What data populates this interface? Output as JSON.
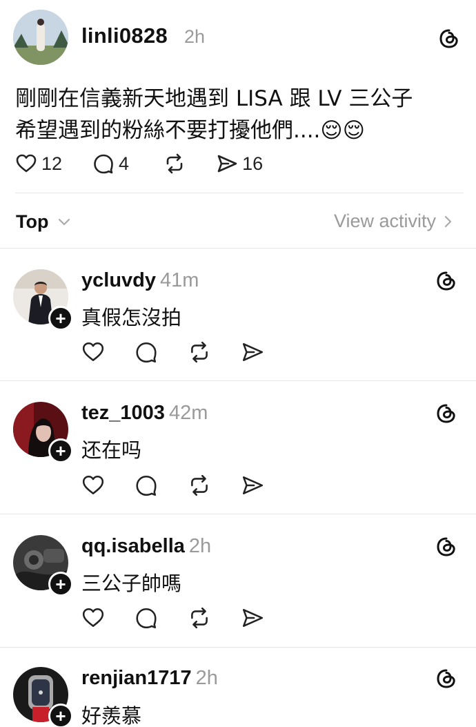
{
  "post": {
    "username": "linli0828",
    "time": "2h",
    "lines": [
      "剛剛在信義新天地遇到 LISA 跟 LV 三公子",
      "希望遇到的粉絲不要打擾他們....😌😌"
    ],
    "likes": "12",
    "comments": "4",
    "shares": "16"
  },
  "sort": {
    "label": "Top",
    "view_activity": "View activity"
  },
  "replies": [
    {
      "username": "ycluvdy",
      "time": "41m",
      "text": "真假怎沒拍"
    },
    {
      "username": "tez_1003",
      "time": "42m",
      "text": "还在吗"
    },
    {
      "username": "qq.isabella",
      "time": "2h",
      "text": "三公子帥嗎"
    },
    {
      "username": "renjian1717",
      "time": "2h",
      "text": "好羨慕"
    }
  ],
  "colors": {
    "text": "#111111",
    "muted": "#9a9a9a",
    "divider": "#e6e6e6"
  }
}
